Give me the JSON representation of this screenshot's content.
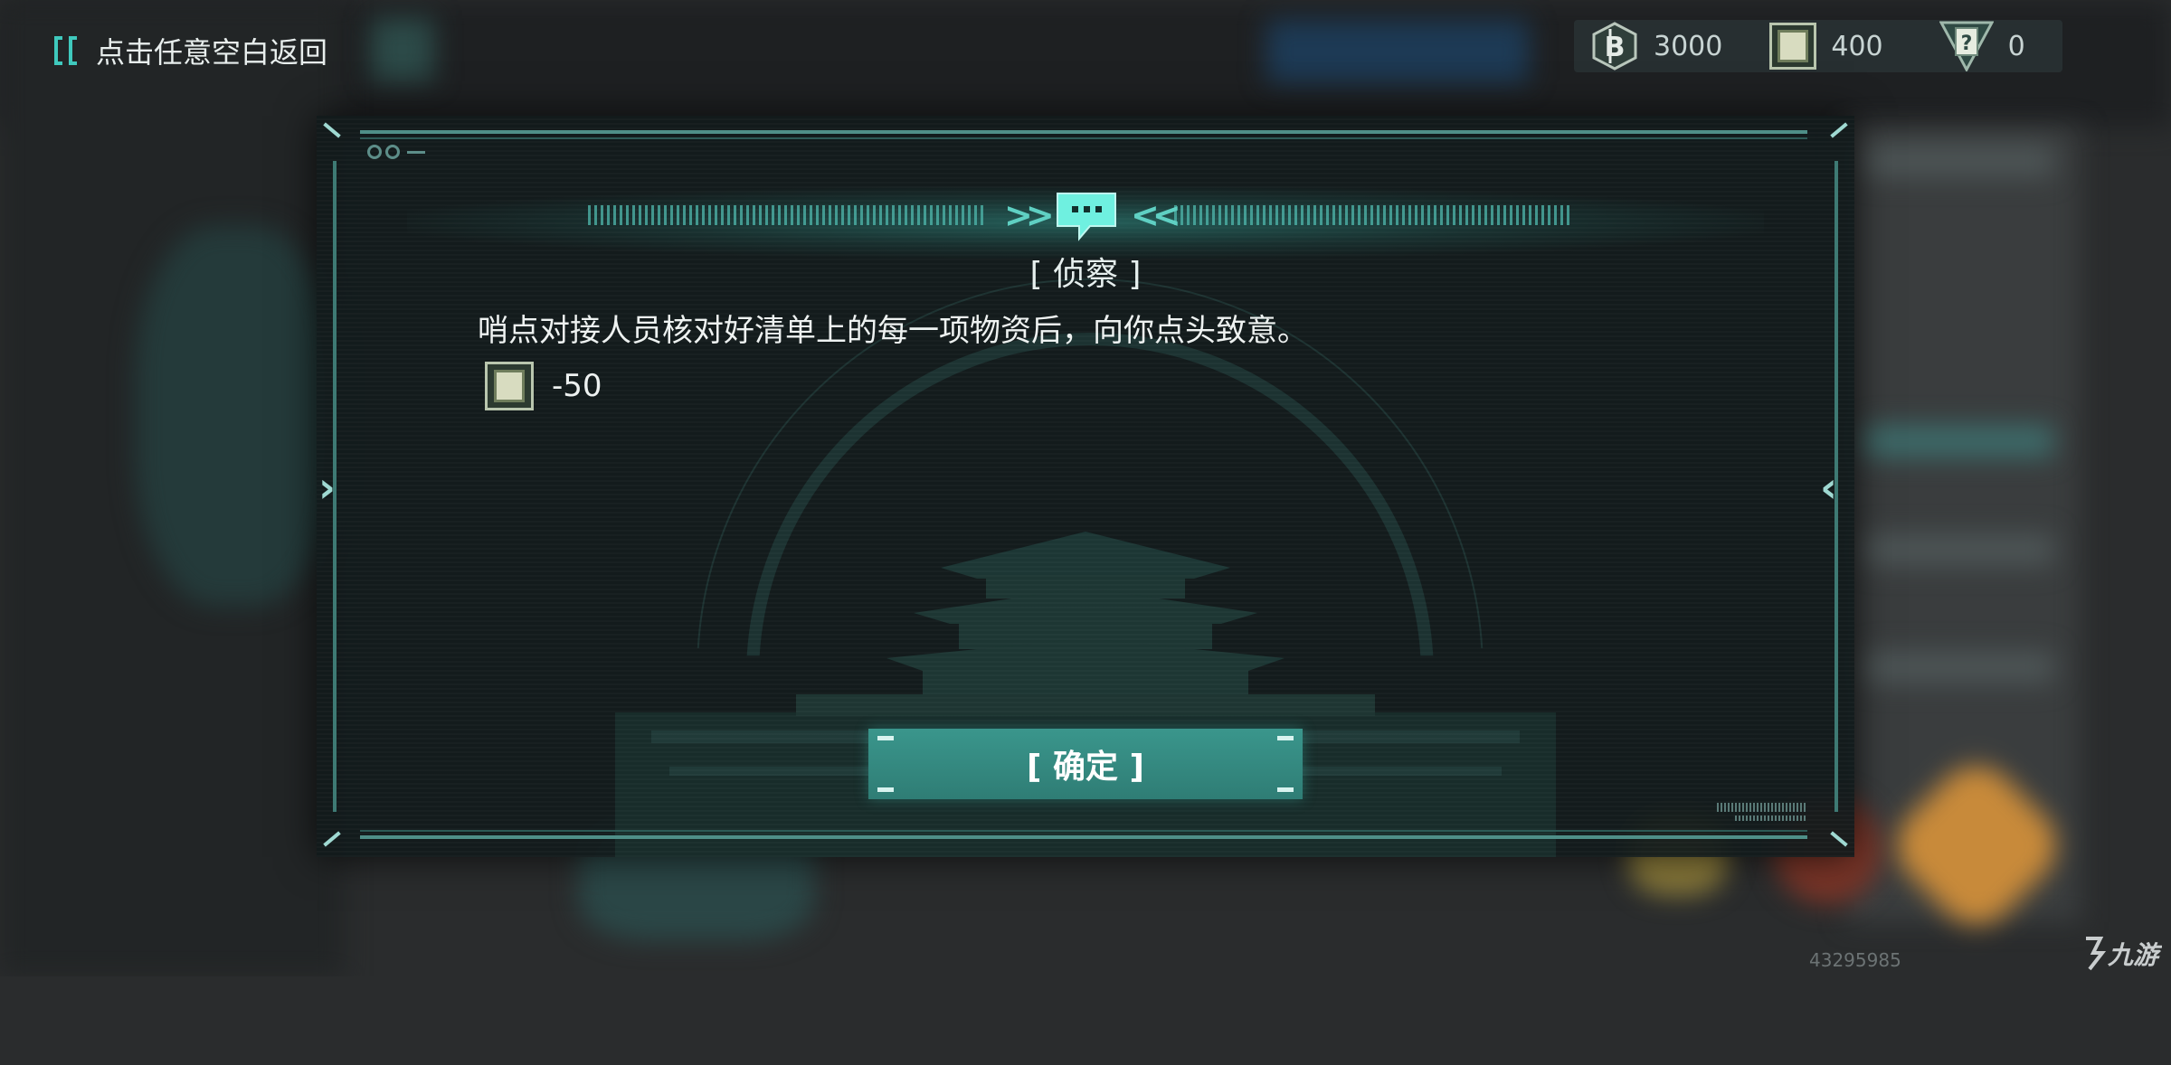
{
  "top_bar": {
    "back_hint": "点击任意空白返回",
    "currencies": [
      {
        "icon": "coin-b-icon",
        "value": "3000"
      },
      {
        "icon": "supply-paper-icon",
        "value": "400"
      },
      {
        "icon": "question-card-icon",
        "value": "0"
      }
    ]
  },
  "dialog": {
    "title": "[ 侦察 ]",
    "message": "哨点对接人员核对好清单上的每一项物资后，向你点头致意。",
    "cost": {
      "icon": "supply-paper-icon",
      "value": "-50"
    },
    "confirm_label": "[ 确定 ]"
  },
  "watermark": {
    "id": "43295985",
    "logo_text": "九游"
  },
  "colors": {
    "accent": "#3fc9bd",
    "button": "#3a968c",
    "panel": "#111a1b",
    "text": "#eef2f1"
  }
}
